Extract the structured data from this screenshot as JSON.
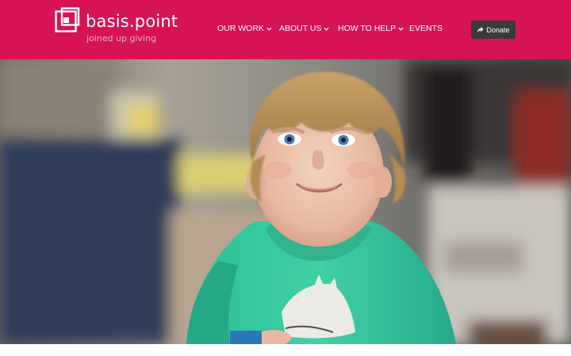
{
  "brand": {
    "name": "basis.point",
    "tagline": "joined up giving",
    "accent_color": "#d61455",
    "logo_icon": "basis-point-logo-icon"
  },
  "nav": {
    "items": [
      {
        "label": "OUR WORK",
        "has_dropdown": true
      },
      {
        "label": "ABOUT US",
        "has_dropdown": true
      },
      {
        "label": "HOW TO HELP",
        "has_dropdown": true
      },
      {
        "label": "EVENTS",
        "has_dropdown": false
      }
    ]
  },
  "donate": {
    "label": "Donate",
    "icon": "share-arrow-icon",
    "color": "#3a3a3a"
  },
  "hero": {
    "image": "smiling-child-photo"
  }
}
